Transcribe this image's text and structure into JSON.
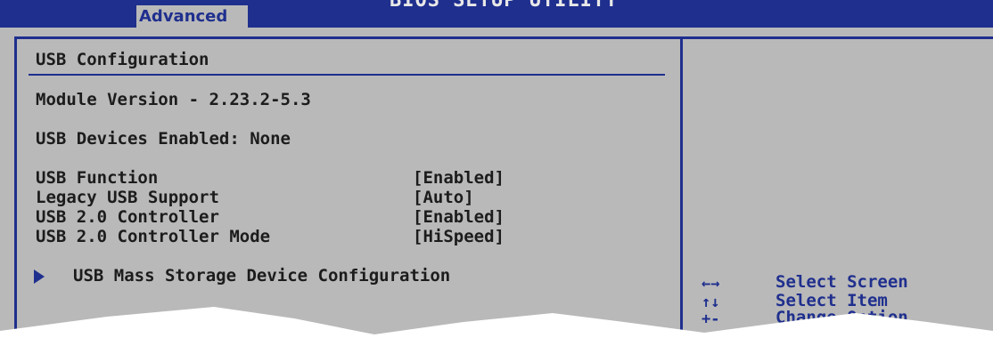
{
  "header": {
    "active_tab": "Advanced",
    "title": "BIOS SETUP UTILITY"
  },
  "main": {
    "section_title": "USB Configuration",
    "module_version": "Module Version - 2.23.2-5.3",
    "devices_enabled": "USB Devices Enabled: None",
    "settings": [
      {
        "label": "USB Function",
        "value": "[Enabled]"
      },
      {
        "label": "Legacy USB Support",
        "value": "[Auto]"
      },
      {
        "label": "USB 2.0 Controller",
        "value": "[Enabled]"
      },
      {
        "label": "USB 2.0 Controller Mode",
        "value": "[HiSpeed]"
      }
    ],
    "submenu": {
      "label": "USB Mass Storage Device Configuration",
      "icon": "triangle-right-icon"
    }
  },
  "help": {
    "keys": [
      {
        "key": "←→",
        "action": "Select Screen"
      },
      {
        "key": "↑↓",
        "action": "Select Item"
      },
      {
        "key": "+-",
        "action": "Change Option"
      }
    ]
  },
  "colors": {
    "background": "#b9b9b9",
    "accent_blue": "#1f2f8e"
  }
}
